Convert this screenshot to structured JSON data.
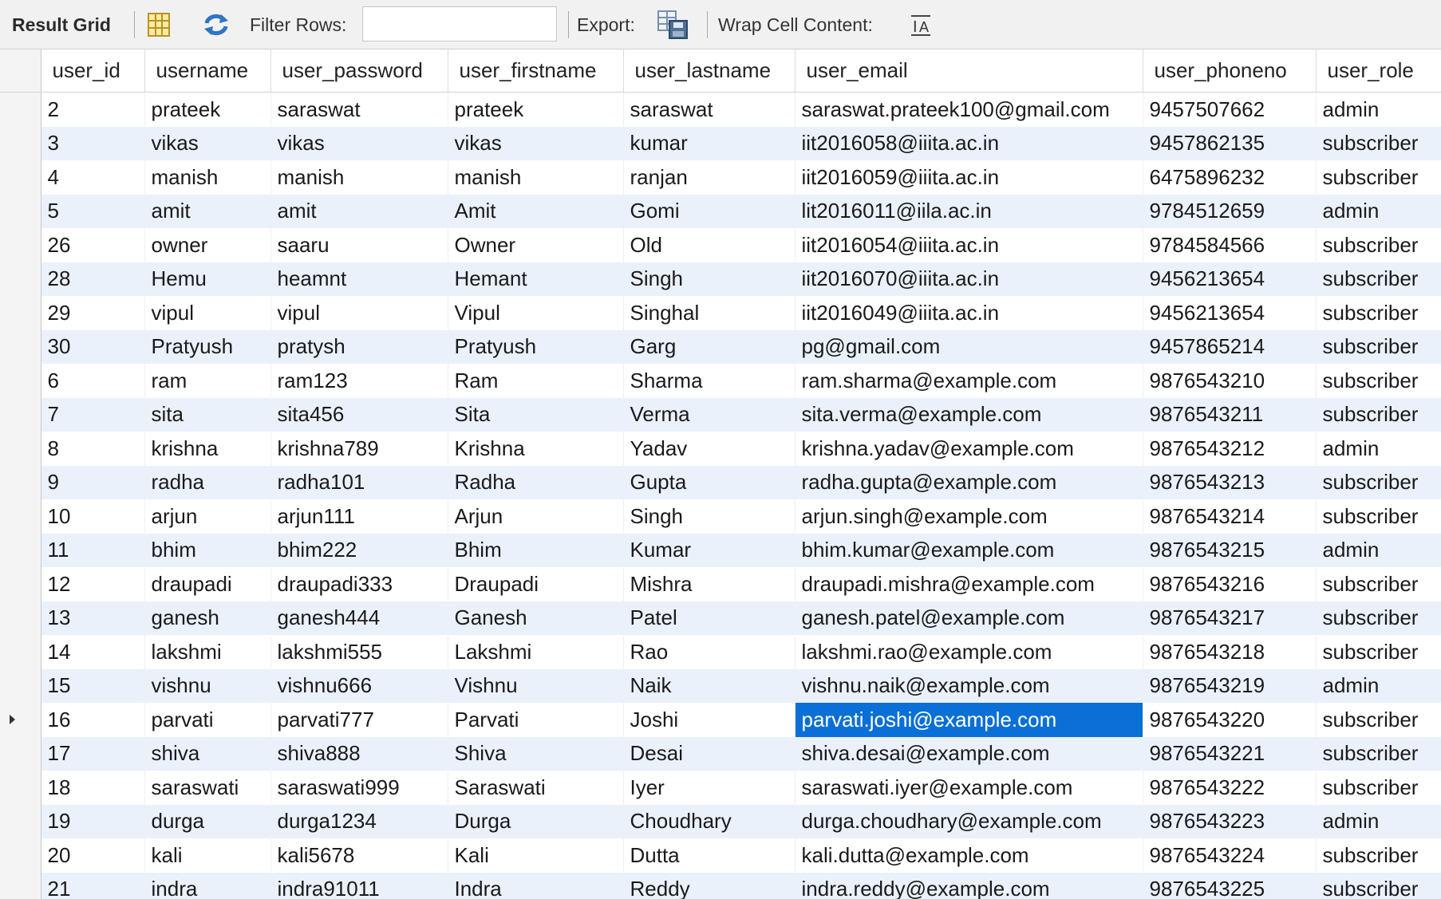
{
  "toolbar": {
    "title": "Result Grid",
    "filter_label": "Filter Rows:",
    "filter_value": "",
    "export_label": "Export:",
    "wrap_label": "Wrap Cell Content:",
    "icons": [
      "grid-form-icon",
      "refresh-icon",
      "export-icon",
      "wrap-text-icon"
    ]
  },
  "columns": [
    "user_id",
    "username",
    "user_password",
    "user_firstname",
    "user_lastname",
    "user_email",
    "user_phoneno",
    "user_role"
  ],
  "rows": [
    [
      "2",
      "prateek",
      "saraswat",
      "prateek",
      "saraswat",
      "saraswat.prateek100@gmail.com",
      "9457507662",
      "admin"
    ],
    [
      "3",
      "vikas",
      "vikas",
      "vikas",
      "kumar",
      "iit2016058@iiita.ac.in",
      "9457862135",
      "subscriber"
    ],
    [
      "4",
      "manish",
      "manish",
      "manish",
      "ranjan",
      "iit2016059@iiita.ac.in",
      "6475896232",
      "subscriber"
    ],
    [
      "5",
      "amit",
      "amit",
      "Amit",
      "Gomi",
      "lit2016011@iila.ac.in",
      "9784512659",
      "admin"
    ],
    [
      "26",
      "owner",
      "saaru",
      "Owner",
      "Old",
      "iit2016054@iiita.ac.in",
      "9784584566",
      "subscriber"
    ],
    [
      "28",
      "Hemu",
      "heamnt",
      "Hemant",
      "Singh",
      "iit2016070@iiita.ac.in",
      "9456213654",
      "subscriber"
    ],
    [
      "29",
      "vipul",
      "vipul",
      "Vipul",
      "Singhal",
      "iit2016049@iiita.ac.in",
      "9456213654",
      "subscriber"
    ],
    [
      "30",
      "Pratyush",
      "pratysh",
      "Pratyush",
      "Garg",
      "pg@gmail.com",
      "9457865214",
      "subscriber"
    ],
    [
      "6",
      "ram",
      "ram123",
      "Ram",
      "Sharma",
      "ram.sharma@example.com",
      "9876543210",
      "subscriber"
    ],
    [
      "7",
      "sita",
      "sita456",
      "Sita",
      "Verma",
      "sita.verma@example.com",
      "9876543211",
      "subscriber"
    ],
    [
      "8",
      "krishna",
      "krishna789",
      "Krishna",
      "Yadav",
      "krishna.yadav@example.com",
      "9876543212",
      "admin"
    ],
    [
      "9",
      "radha",
      "radha101",
      "Radha",
      "Gupta",
      "radha.gupta@example.com",
      "9876543213",
      "subscriber"
    ],
    [
      "10",
      "arjun",
      "arjun111",
      "Arjun",
      "Singh",
      "arjun.singh@example.com",
      "9876543214",
      "subscriber"
    ],
    [
      "11",
      "bhim",
      "bhim222",
      "Bhim",
      "Kumar",
      "bhim.kumar@example.com",
      "9876543215",
      "admin"
    ],
    [
      "12",
      "draupadi",
      "draupadi333",
      "Draupadi",
      "Mishra",
      "draupadi.mishra@example.com",
      "9876543216",
      "subscriber"
    ],
    [
      "13",
      "ganesh",
      "ganesh444",
      "Ganesh",
      "Patel",
      "ganesh.patel@example.com",
      "9876543217",
      "subscriber"
    ],
    [
      "14",
      "lakshmi",
      "lakshmi555",
      "Lakshmi",
      "Rao",
      "lakshmi.rao@example.com",
      "9876543218",
      "subscriber"
    ],
    [
      "15",
      "vishnu",
      "vishnu666",
      "Vishnu",
      "Naik",
      "vishnu.naik@example.com",
      "9876543219",
      "admin"
    ],
    [
      "16",
      "parvati",
      "parvati777",
      "Parvati",
      "Joshi",
      "parvati.joshi@example.com",
      "9876543220",
      "subscriber"
    ],
    [
      "17",
      "shiva",
      "shiva888",
      "Shiva",
      "Desai",
      "shiva.desai@example.com",
      "9876543221",
      "subscriber"
    ],
    [
      "18",
      "saraswati",
      "saraswati999",
      "Saraswati",
      "Iyer",
      "saraswati.iyer@example.com",
      "9876543222",
      "subscriber"
    ],
    [
      "19",
      "durga",
      "durga1234",
      "Durga",
      "Choudhary",
      "durga.choudhary@example.com",
      "9876543223",
      "admin"
    ],
    [
      "20",
      "kali",
      "kali5678",
      "Kali",
      "Dutta",
      "kali.dutta@example.com",
      "9876543224",
      "subscriber"
    ],
    [
      "21",
      "indra",
      "indra91011",
      "Indra",
      "Reddy",
      "indra.reddy@example.com",
      "9876543225",
      "subscriber"
    ]
  ],
  "current_row_index": 18,
  "selected_cell": {
    "row": 18,
    "col": 5
  },
  "colors": {
    "selection": "#0a6fd6",
    "alt_row": "#eaf1fb",
    "toolbar_bg": "#f1f1f1"
  }
}
